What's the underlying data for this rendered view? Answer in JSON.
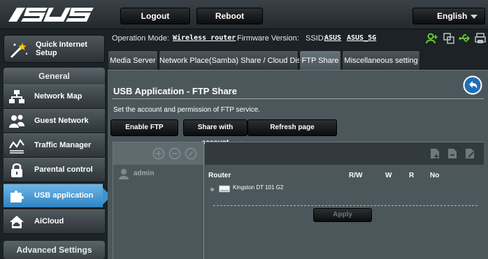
{
  "header": {
    "brand": "ASUS",
    "logout_label": "Logout",
    "reboot_label": "Reboot",
    "language": "English"
  },
  "sidebar": {
    "quick_setup_label": "Quick Internet Setup",
    "general_label": "General",
    "items": [
      {
        "label": "Network Map",
        "icon": "network-map-icon"
      },
      {
        "label": "Guest Network",
        "icon": "guest-network-icon"
      },
      {
        "label": "Traffic Manager",
        "icon": "traffic-manager-icon"
      },
      {
        "label": "Parental control",
        "icon": "lock-icon"
      },
      {
        "label": "USB application",
        "icon": "puzzle-icon"
      },
      {
        "label": "AiCloud",
        "icon": "cloud-icon"
      }
    ],
    "active_index": 4,
    "advanced_label": "Advanced Settings"
  },
  "status": {
    "mode_label": "Operation Mode:",
    "mode_value": "Wireless router",
    "firmware_label": "Firmware Version:",
    "ssid_label": "SSID:",
    "ssid_1": "ASUS",
    "ssid_2": "ASUS_5G",
    "icons": [
      "user-icon",
      "copy-icon",
      "usb-icon",
      "printer-icon"
    ]
  },
  "tabs": [
    {
      "label": "Media Server"
    },
    {
      "label": "Network Place(Samba) Share / Cloud Disk"
    },
    {
      "label": "FTP Share"
    },
    {
      "label": "Miscellaneous setting"
    }
  ],
  "active_tab": 2,
  "panel": {
    "title": "USB Application - FTP Share",
    "description": "Set the account and permission of FTP service.",
    "enable_ftp_label": "Enable FTP",
    "share_account_label": "Share with account",
    "refresh_label": "Refresh page",
    "apply_label": "Apply"
  },
  "accounts": {
    "users": [
      "admin"
    ],
    "columns": {
      "router": "Router",
      "rw": "R/W",
      "w": "W",
      "r": "R",
      "no": "No"
    },
    "device_name": "Kingston DT 101 G2"
  },
  "colors": {
    "accent": "#3f93d0",
    "panel_bg": "#4c575c",
    "page_bg": "#1c2225",
    "status_green": "#66cc33"
  }
}
